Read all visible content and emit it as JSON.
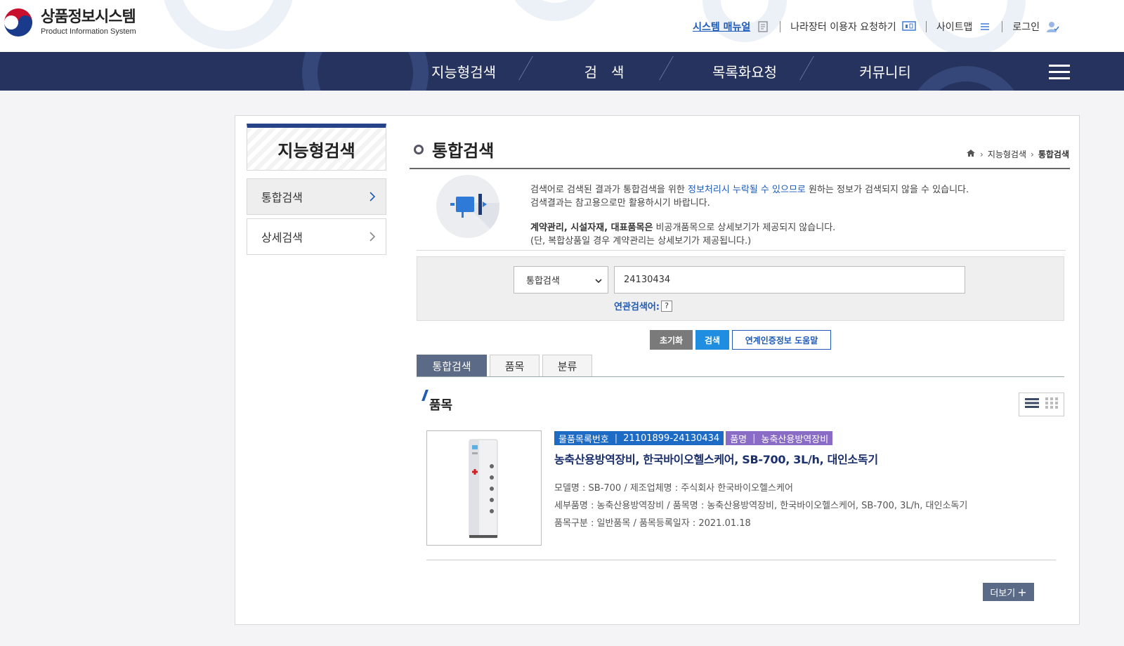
{
  "header": {
    "logo_ko": "상품정보시스템",
    "logo_en": "Product Information System",
    "util": {
      "manual": "시스템 매뉴얼",
      "request": "나라장터 이용자 요청하기",
      "sitemap": "사이트맵",
      "login": "로그인"
    }
  },
  "gnb": {
    "items": [
      "지능형검색",
      "검　색",
      "목록화요청",
      "커뮤니티"
    ]
  },
  "lnb": {
    "title": "지능형검색",
    "items": [
      "통합검색",
      "상세검색"
    ]
  },
  "page": {
    "title": "통합검색",
    "breadcrumb": [
      "지능형검색",
      "통합검색"
    ]
  },
  "notice": {
    "line1_pre": "검색어로 검색된 결과가 통합검색을 위한 ",
    "line1_blue": "정보처리시 누락될 수 있으므로",
    "line1_post": " 원하는 정보가 검색되지 않을 수 있습니다.",
    "line2": "검색결과는 참고용으로만 활용하시기 바랍니다.",
    "line3_bold": "계약관리, 시설자재, 대표품목은",
    "line3_post": " 비공개품목으로 상세보기가 제공되지 않습니다.",
    "line4": "(단, 복합상품일 경우 계약관리는 상세보기가 제공됩니다.)"
  },
  "search": {
    "select_value": "통합검색",
    "input_value": "24130434",
    "related_label": "연관검색어:",
    "help_mark": "?"
  },
  "buttons": {
    "reset": "초기화",
    "search": "검색",
    "help": "연계인증정보 도움말"
  },
  "tabs": [
    "통합검색",
    "품목",
    "분류"
  ],
  "section": {
    "title": "품목"
  },
  "result": {
    "tag1_label": "물품목록번호",
    "tag1_value": "21101899-24130434",
    "tag2_label": "품명",
    "tag2_value": "농축산용방역장비",
    "title": "농축산용방역장비, 한국바이오헬스케어, SB-700, 3L/h, 대인소독기",
    "meta1": "모델명 : SB-700 / 제조업체명 : 주식회사 한국바이오헬스케어",
    "meta2": "세부품명 : 농축산용방역장비 / 품목명 : 농축산용방역장비, 한국바이오헬스케어, SB-700, 3L/h, 대인소독기",
    "meta3": "품목구분 : 일반품목 / 품목등록일자 : 2021.01.18"
  },
  "more": {
    "label": "더보기"
  },
  "colors": {
    "gnb_bg": "#26335f",
    "accent_blue": "#1e5bb8",
    "search_btn": "#1f8de0",
    "tag_blue": "#1e6bc6",
    "tag_purple": "#8a6bc6",
    "tab_active": "#5b6a86"
  }
}
